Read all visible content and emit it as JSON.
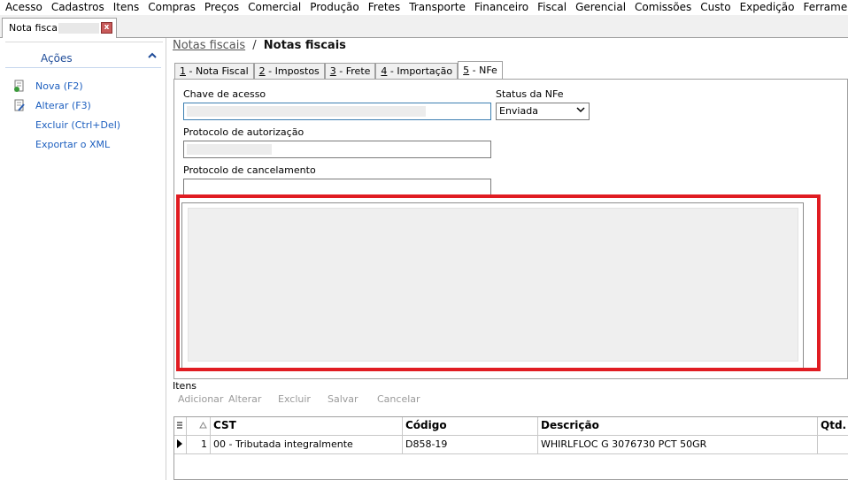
{
  "menu": [
    "Acesso",
    "Cadastros",
    "Itens",
    "Compras",
    "Preços",
    "Comercial",
    "Produção",
    "Fretes",
    "Transporte",
    "Financeiro",
    "Fiscal",
    "Gerencial",
    "Comissões",
    "Custo",
    "Expedição",
    "Ferramentas"
  ],
  "doc_tab": {
    "label": "Nota fiscal",
    "close": "x"
  },
  "left_panel": {
    "title": "Ações",
    "collapse_icon": "chevron-up-icon",
    "actions": [
      "Nova (F2)",
      "Alterar (F3)",
      "Excluir (Ctrl+Del)",
      "Exportar o XML"
    ]
  },
  "breadcrumb": {
    "parent": "Notas fiscais",
    "separator": "/",
    "current": "Notas fiscais"
  },
  "tabs": [
    {
      "key": "1",
      "label": " - Nota Fiscal"
    },
    {
      "key": "2",
      "label": " - Impostos"
    },
    {
      "key": "3",
      "label": " - Frete"
    },
    {
      "key": "4",
      "label": " - Importação"
    },
    {
      "key": "5",
      "label": " - NFe"
    }
  ],
  "active_tab": "5",
  "nfe": {
    "chave_label": "Chave de acesso",
    "status_label": "Status da NFe",
    "status_value": "Enviada",
    "protocolo_aut_label": "Protocolo de autorização",
    "protocolo_canc_label": "Protocolo de cancelamento"
  },
  "items": {
    "label": "Itens",
    "toolbar": [
      "Adicionar",
      "Alterar",
      "Excluir",
      "Salvar",
      "Cancelar"
    ],
    "columns": [
      "CST",
      "Código",
      "Descrição",
      "Qtd."
    ],
    "rows": [
      {
        "index": "1",
        "cst": "00 - Tributada integralmente",
        "codigo": "D858-19",
        "descricao": "WHIRLFLOC G 3076730 PCT 50GR",
        "qtd": ""
      }
    ]
  },
  "colors": {
    "highlight": "#e01c22",
    "link": "#1d5fbf",
    "header_blue": "#1f4c99"
  }
}
